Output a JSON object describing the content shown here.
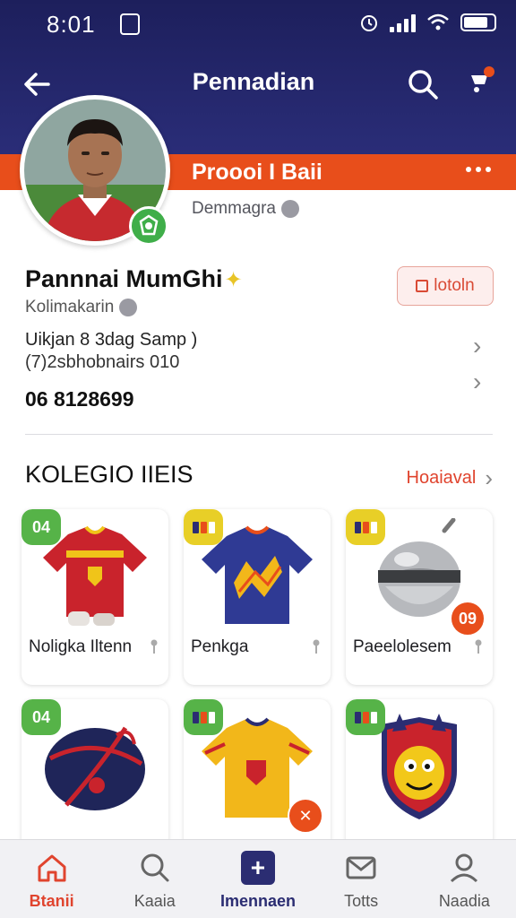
{
  "status_bar": {
    "time": "8:01"
  },
  "header": {
    "title": "Pennadian",
    "banner_title": "Proooi I Baii"
  },
  "profile": {
    "subtext": "Demmagra",
    "name": "Pannnai MumGhi",
    "location": "Kolimakarin",
    "info_line_1": "Uikjan 8 3dag Samp )",
    "info_line_2": "(7)2sbhobnairs 010",
    "phone": "06 8128699",
    "edit_label": "lotoln"
  },
  "section": {
    "title": "KOLEGIO IIEIS",
    "link_label": "Hoaiaval"
  },
  "cards": [
    {
      "tag": "04",
      "label": "Noligka Iltenn"
    },
    {
      "tag": "",
      "label": "Penkga"
    },
    {
      "tag": "",
      "label": "Paeelolesem",
      "badge": "09"
    },
    {
      "tag": "04",
      "label": ""
    },
    {
      "tag": "",
      "label": ""
    },
    {
      "tag": "",
      "label": ""
    }
  ],
  "bottom_nav": [
    {
      "label": "Btanii",
      "icon": "home-icon",
      "active": true
    },
    {
      "label": "Kaaia",
      "icon": "search-icon"
    },
    {
      "label": "Imennaen",
      "icon": "plus-icon"
    },
    {
      "label": "Totts",
      "icon": "mail-icon"
    },
    {
      "label": "Naadia",
      "icon": "user-icon"
    }
  ],
  "colors": {
    "header": "#1d1f5c",
    "accent": "#e84e1b",
    "green": "#56b348",
    "yellow": "#e8cf27"
  }
}
